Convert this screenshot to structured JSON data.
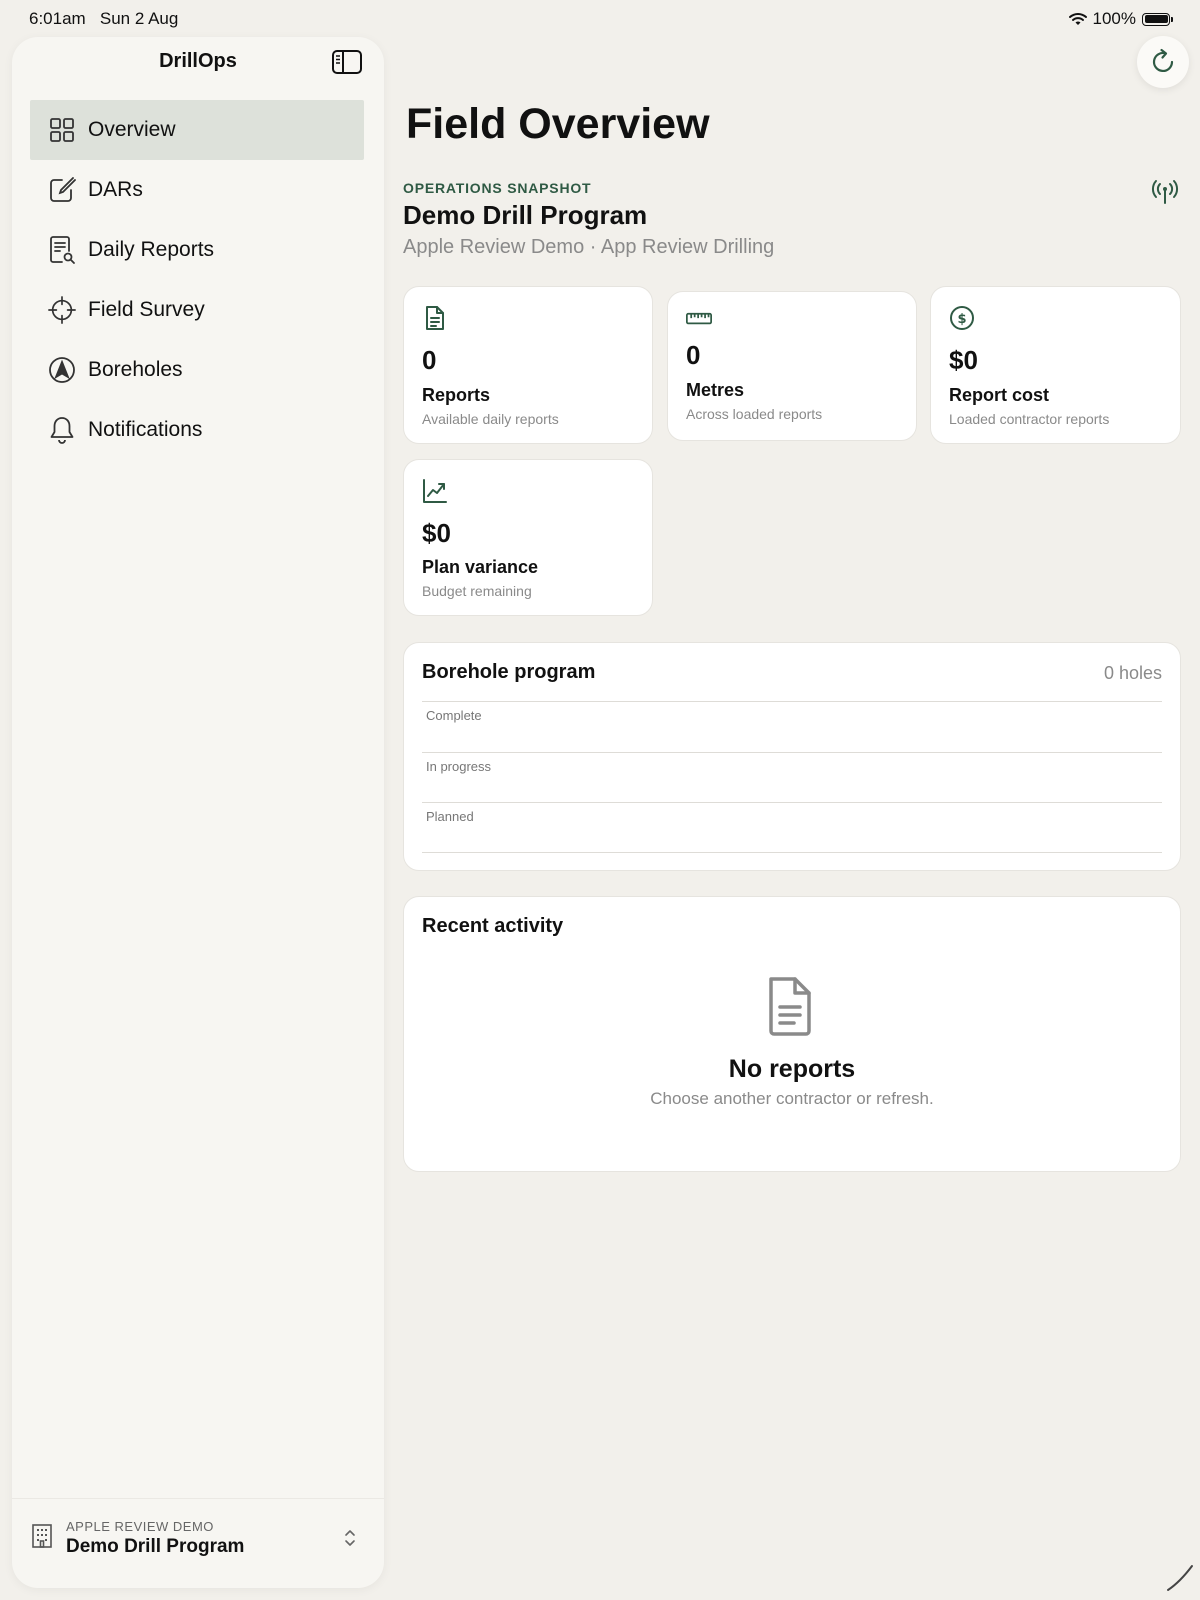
{
  "status_bar": {
    "time": "6:01am",
    "date": "Sun 2 Aug",
    "battery": "100%"
  },
  "sidebar": {
    "title": "DrillOps",
    "items": [
      {
        "label": "Overview",
        "icon": "grid-icon",
        "active": true
      },
      {
        "label": "DARs",
        "icon": "compose-icon"
      },
      {
        "label": "Daily Reports",
        "icon": "report-search-icon"
      },
      {
        "label": "Field Survey",
        "icon": "crosshair-icon"
      },
      {
        "label": "Boreholes",
        "icon": "location-arrow-icon"
      },
      {
        "label": "Notifications",
        "icon": "bell-icon"
      }
    ],
    "footer": {
      "org": "APPLE REVIEW DEMO",
      "program": "Demo Drill Program"
    }
  },
  "main": {
    "title": "Field Overview",
    "snapshot_label": "OPERATIONS SNAPSHOT",
    "program_title": "Demo Drill Program",
    "program_subtitle": "Apple Review Demo · App Review Drilling",
    "stats": [
      {
        "value": "0",
        "label": "Reports",
        "sub": "Available daily reports",
        "icon": "document-icon"
      },
      {
        "value": "0",
        "label": "Metres",
        "sub": "Across loaded reports",
        "icon": "ruler-icon"
      },
      {
        "value": "$0",
        "label": "Report cost",
        "sub": "Loaded contractor reports",
        "icon": "dollar-icon"
      },
      {
        "value": "$0",
        "label": "Plan variance",
        "sub": "Budget remaining",
        "icon": "trend-icon"
      }
    ],
    "borehole_program": {
      "title": "Borehole program",
      "count": "0 holes",
      "rows": [
        "Complete",
        "In progress",
        "Planned"
      ]
    },
    "recent_activity": {
      "title": "Recent activity",
      "empty_title": "No reports",
      "empty_subtitle": "Choose another contractor or refresh."
    }
  },
  "colors": {
    "accent": "#2f5a44",
    "background": "#f2f0eb",
    "sidebar_active": "#dde1da"
  }
}
